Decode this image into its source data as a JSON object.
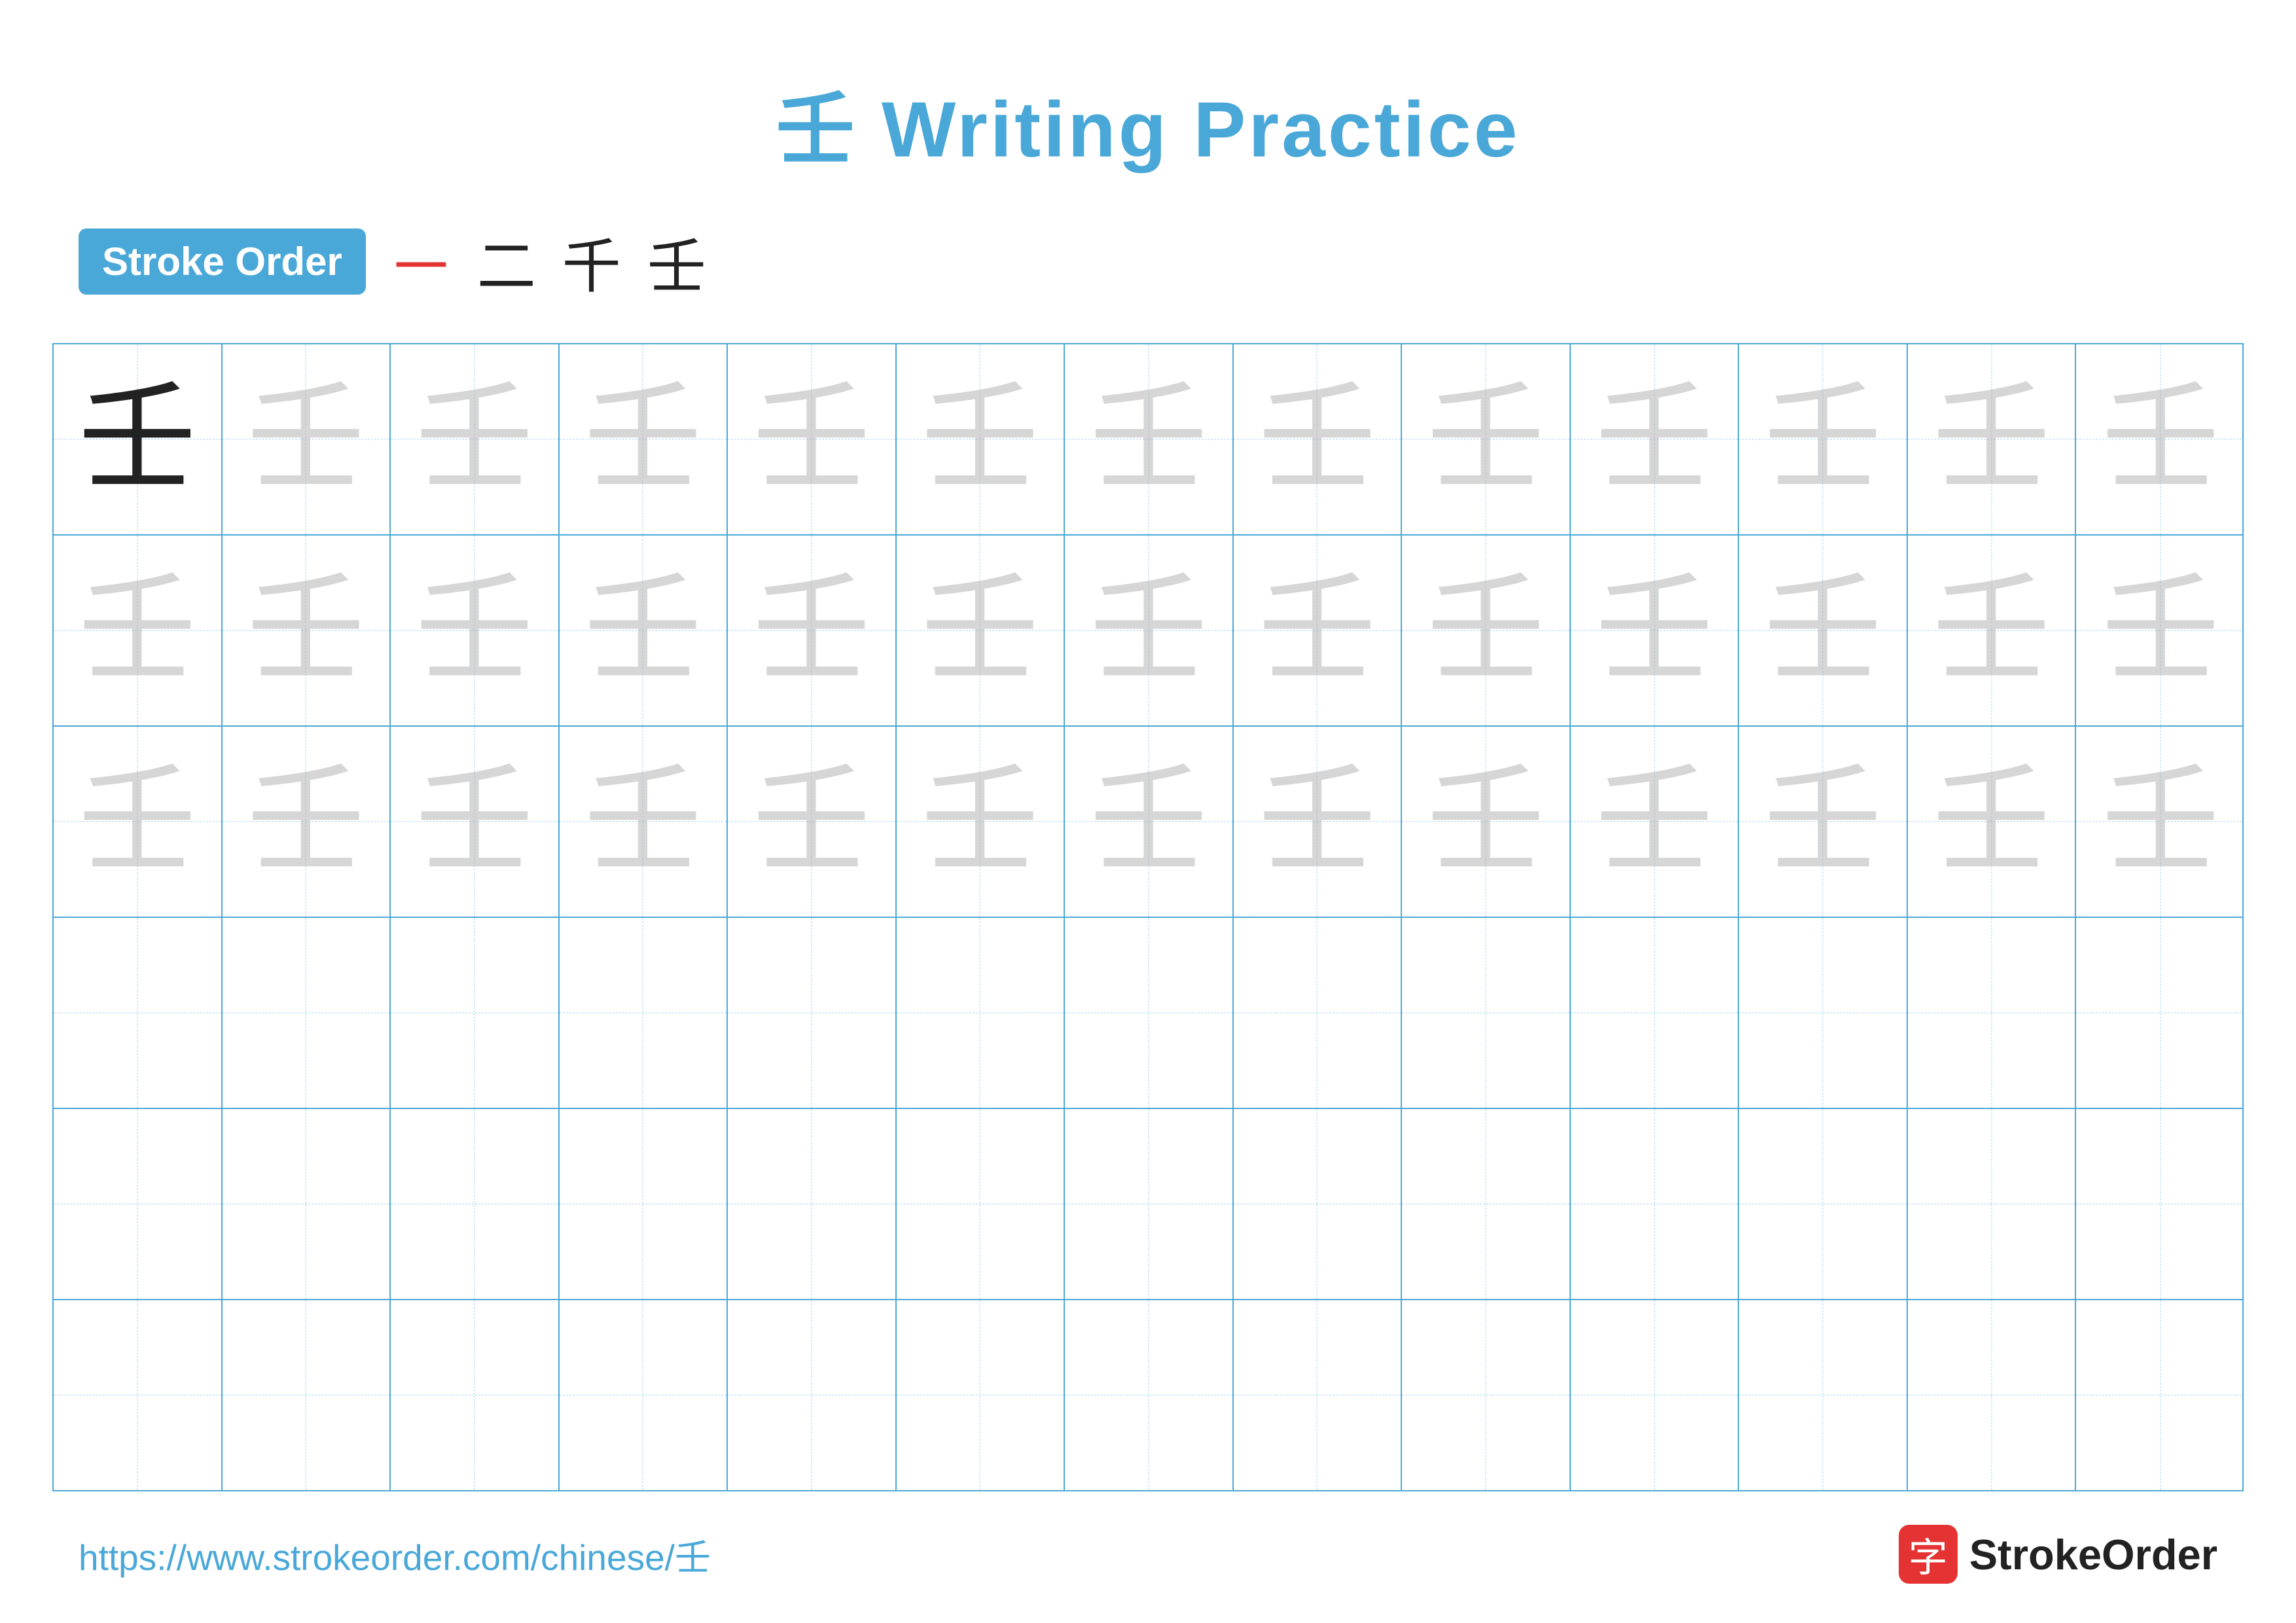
{
  "page": {
    "title": "壬 Writing Practice",
    "title_char": "壬",
    "title_text": "Writing Practice"
  },
  "stroke_order": {
    "badge_label": "Stroke Order",
    "strokes": [
      "㇐",
      "二",
      "千",
      "壬"
    ]
  },
  "grid": {
    "rows": 6,
    "cols": 13,
    "character": "壬",
    "faded_rows": [
      0,
      1,
      2
    ],
    "empty_rows": [
      3,
      4,
      5
    ]
  },
  "footer": {
    "url": "https://www.strokeorder.com/chinese/壬",
    "logo_char": "字",
    "logo_text": "StrokeOrder"
  }
}
